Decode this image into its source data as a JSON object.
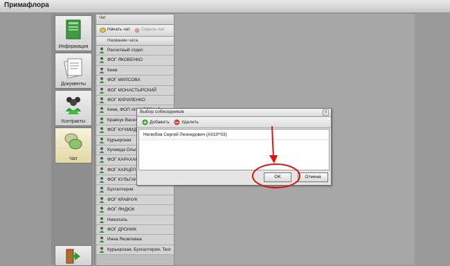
{
  "app": {
    "title": "Примафлора"
  },
  "nav": [
    {
      "label": "Информация",
      "icon": "book-icon"
    },
    {
      "label": "Документы",
      "icon": "documents-icon"
    },
    {
      "label": "Контракты",
      "icon": "contacts-icon"
    },
    {
      "label": "Чат",
      "icon": "chat-icon"
    }
  ],
  "panel": {
    "header": "Чат",
    "start_chat": "Начать чат",
    "hide_chat": "Скрыть чат",
    "column_header": "Название чата",
    "rows": [
      "Расчетный отдел",
      "ФОГ ЯКОВЕНКО",
      "Киев",
      "ФОГ МИЛСОВА",
      "ФОГ МОНАСТЫРСКИЙ",
      "ФОГ КИРИЛЕНКО",
      "Киев, ФОП АНИКЕЕВА, Бухгалтерия",
      "Кравчук Васил",
      "ФОГ КУЧМИДА",
      "Курьерская",
      "Кучмида Ольга",
      "ФОГ КАРАХАН",
      "ФОГ КАРЦЕПК",
      "ФОГ КУЛЬГАН",
      "Бухгалтерия",
      "ФОГ КРАВЧУК",
      "ФОГ ЯНДЮК",
      "Никополь",
      "ФОГ ДРОНИК",
      "Инна Яковлевна",
      "Курьерская, Бухгалтерия, Test"
    ]
  },
  "dialog": {
    "title": "Выбор собеседников",
    "add": "Добавить",
    "remove": "Удалить",
    "entries": [
      "Нелюбов Сергей Леонидович (А010^03)"
    ],
    "ok": "OK",
    "cancel": "Отмена"
  },
  "colors": {
    "annotation": "#e01010",
    "user_green": "#2e9a2e",
    "add_green": "#2f9a1f",
    "remove_red": "#c8452a"
  }
}
